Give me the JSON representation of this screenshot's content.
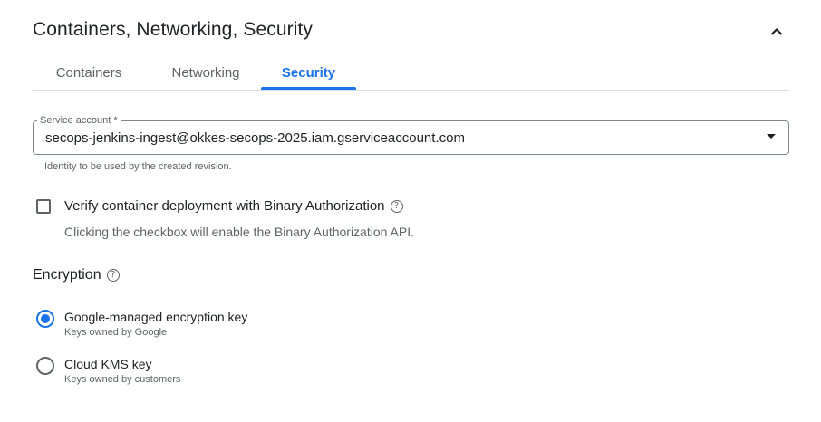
{
  "section": {
    "title": "Containers, Networking, Security",
    "collapse_icon": "chevron-up-icon"
  },
  "tabs": [
    {
      "label": "Containers",
      "active": false
    },
    {
      "label": "Networking",
      "active": false
    },
    {
      "label": "Security",
      "active": true
    }
  ],
  "service_account": {
    "label": "Service account *",
    "value": "secops-jenkins-ingest@okkes-secops-2025.iam.gserviceaccount.com",
    "helper": "Identity to be used by the created revision.",
    "dropdown_icon": "dropdown-arrow-icon"
  },
  "binary_auth": {
    "label": "Verify container deployment with Binary Authorization",
    "description": "Clicking the checkbox will enable the Binary Authorization API.",
    "checked": false,
    "help_icon": "help-icon"
  },
  "encryption": {
    "title": "Encryption",
    "options": [
      {
        "label": "Google-managed encryption key",
        "sub": "Keys owned by Google",
        "selected": true
      },
      {
        "label": "Cloud KMS key",
        "sub": "Keys owned by customers",
        "selected": false
      }
    ]
  },
  "colors": {
    "accent": "#1a73e8",
    "text": "#202124",
    "secondary_text": "#5f6368",
    "divider": "#dadce0"
  }
}
